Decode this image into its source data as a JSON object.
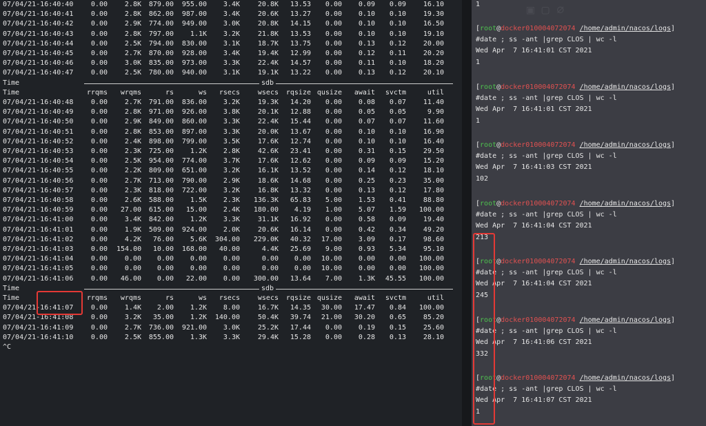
{
  "iostat": {
    "columns": [
      "Time",
      "rrqms",
      "wrqms",
      "rs",
      "ws",
      "rsecs",
      "wsecs",
      "rqsize",
      "qusize",
      "await",
      "svctm",
      "util"
    ],
    "separator_label": "sdb",
    "blocks": [
      {
        "rows": [
          [
            "07/04/21-16:40:40",
            "0.00",
            "2.8K",
            "879.00",
            "955.00",
            "3.4K",
            "20.8K",
            "13.53",
            "0.00",
            "0.09",
            "0.09",
            "16.10"
          ],
          [
            "07/04/21-16:40:41",
            "0.00",
            "2.8K",
            "862.00",
            "987.00",
            "3.4K",
            "20.6K",
            "13.27",
            "0.00",
            "0.10",
            "0.10",
            "19.30"
          ],
          [
            "07/04/21-16:40:42",
            "0.00",
            "2.9K",
            "774.00",
            "949.00",
            "3.0K",
            "20.8K",
            "14.15",
            "0.00",
            "0.10",
            "0.10",
            "16.50"
          ],
          [
            "07/04/21-16:40:43",
            "0.00",
            "2.8K",
            "797.00",
            "1.1K",
            "3.2K",
            "21.8K",
            "13.53",
            "0.00",
            "0.10",
            "0.10",
            "19.10"
          ],
          [
            "07/04/21-16:40:44",
            "0.00",
            "2.5K",
            "794.00",
            "830.00",
            "3.1K",
            "18.7K",
            "13.75",
            "0.00",
            "0.13",
            "0.12",
            "20.00"
          ],
          [
            "07/04/21-16:40:45",
            "0.00",
            "2.7K",
            "870.00",
            "928.00",
            "3.4K",
            "19.4K",
            "12.99",
            "0.00",
            "0.12",
            "0.11",
            "20.20"
          ],
          [
            "07/04/21-16:40:46",
            "0.00",
            "3.0K",
            "835.00",
            "973.00",
            "3.3K",
            "22.4K",
            "14.57",
            "0.00",
            "0.11",
            "0.10",
            "18.20"
          ],
          [
            "07/04/21-16:40:47",
            "0.00",
            "2.5K",
            "780.00",
            "940.00",
            "3.1K",
            "19.1K",
            "13.22",
            "0.00",
            "0.13",
            "0.12",
            "20.10"
          ]
        ]
      },
      {
        "rows": [
          [
            "07/04/21-16:40:48",
            "0.00",
            "2.7K",
            "791.00",
            "836.00",
            "3.2K",
            "19.3K",
            "14.20",
            "0.00",
            "0.08",
            "0.07",
            "11.40"
          ],
          [
            "07/04/21-16:40:49",
            "0.00",
            "2.8K",
            "971.00",
            "926.00",
            "3.8K",
            "20.1K",
            "12.88",
            "0.00",
            "0.05",
            "0.05",
            "9.90"
          ],
          [
            "07/04/21-16:40:50",
            "0.00",
            "2.9K",
            "849.00",
            "860.00",
            "3.3K",
            "22.4K",
            "15.44",
            "0.00",
            "0.07",
            "0.07",
            "11.60"
          ],
          [
            "07/04/21-16:40:51",
            "0.00",
            "2.8K",
            "853.00",
            "897.00",
            "3.3K",
            "20.0K",
            "13.67",
            "0.00",
            "0.10",
            "0.10",
            "16.90"
          ],
          [
            "07/04/21-16:40:52",
            "0.00",
            "2.4K",
            "898.00",
            "799.00",
            "3.5K",
            "17.6K",
            "12.74",
            "0.00",
            "0.10",
            "0.10",
            "16.40"
          ],
          [
            "07/04/21-16:40:53",
            "0.00",
            "2.3K",
            "725.00",
            "1.2K",
            "2.8K",
            "42.6K",
            "23.41",
            "0.00",
            "0.31",
            "0.15",
            "29.50"
          ],
          [
            "07/04/21-16:40:54",
            "0.00",
            "2.5K",
            "954.00",
            "774.00",
            "3.7K",
            "17.6K",
            "12.62",
            "0.00",
            "0.09",
            "0.09",
            "15.20"
          ],
          [
            "07/04/21-16:40:55",
            "0.00",
            "2.2K",
            "809.00",
            "651.00",
            "3.2K",
            "16.1K",
            "13.52",
            "0.00",
            "0.14",
            "0.12",
            "18.10"
          ],
          [
            "07/04/21-16:40:56",
            "0.00",
            "2.7K",
            "713.00",
            "790.00",
            "2.9K",
            "18.6K",
            "14.68",
            "0.00",
            "0.25",
            "0.23",
            "35.00"
          ],
          [
            "07/04/21-16:40:57",
            "0.00",
            "2.3K",
            "818.00",
            "722.00",
            "3.2K",
            "16.8K",
            "13.32",
            "0.00",
            "0.13",
            "0.12",
            "17.80"
          ],
          [
            "07/04/21-16:40:58",
            "0.00",
            "2.6K",
            "588.00",
            "1.5K",
            "2.3K",
            "136.3K",
            "65.83",
            "5.00",
            "1.53",
            "0.41",
            "88.80"
          ],
          [
            "07/04/21-16:40:59",
            "0.00",
            "27.00",
            "615.00",
            "15.00",
            "2.4K",
            "180.00",
            "4.19",
            "1.00",
            "5.07",
            "1.59",
            "100.00"
          ],
          [
            "07/04/21-16:41:00",
            "0.00",
            "3.4K",
            "842.00",
            "1.2K",
            "3.3K",
            "31.1K",
            "16.92",
            "0.00",
            "0.58",
            "0.09",
            "19.40"
          ],
          [
            "07/04/21-16:41:01",
            "0.00",
            "1.9K",
            "509.00",
            "924.00",
            "2.0K",
            "20.6K",
            "16.14",
            "0.00",
            "0.42",
            "0.34",
            "49.20"
          ],
          [
            "07/04/21-16:41:02",
            "0.00",
            "4.2K",
            "76.00",
            "5.6K",
            "304.00",
            "229.0K",
            "40.32",
            "17.00",
            "3.09",
            "0.17",
            "98.60"
          ],
          [
            "07/04/21-16:41:03",
            "0.00",
            "154.00",
            "10.00",
            "168.00",
            "40.00",
            "4.4K",
            "25.69",
            "9.00",
            "0.93",
            "5.34",
            "95.10"
          ],
          [
            "07/04/21-16:41:04",
            "0.00",
            "0.00",
            "0.00",
            "0.00",
            "0.00",
            "0.00",
            "0.00",
            "10.00",
            "0.00",
            "0.00",
            "100.00"
          ],
          [
            "07/04/21-16:41:05",
            "0.00",
            "0.00",
            "0.00",
            "0.00",
            "0.00",
            "0.00",
            "0.00",
            "10.00",
            "0.00",
            "0.00",
            "100.00"
          ],
          [
            "07/04/21-16:41:06",
            "0.00",
            "46.00",
            "0.00",
            "22.00",
            "0.00",
            "300.00",
            "13.64",
            "7.00",
            "1.3K",
            "45.55",
            "100.00"
          ]
        ]
      },
      {
        "rows": [
          [
            "07/04/21-16:41:07",
            "0.00",
            "1.4K",
            "2.00",
            "1.2K",
            "8.00",
            "16.7K",
            "14.35",
            "30.00",
            "17.47",
            "0.84",
            "100.00"
          ],
          [
            "07/04/21-16:41:08",
            "0.00",
            "3.2K",
            "35.00",
            "1.2K",
            "140.00",
            "50.4K",
            "39.74",
            "21.00",
            "30.20",
            "0.65",
            "85.20"
          ],
          [
            "07/04/21-16:41:09",
            "0.00",
            "2.7K",
            "736.00",
            "921.00",
            "3.0K",
            "25.2K",
            "17.44",
            "0.00",
            "0.19",
            "0.15",
            "25.60"
          ],
          [
            "07/04/21-16:41:10",
            "0.00",
            "2.5K",
            "855.00",
            "1.3K",
            "3.3K",
            "29.4K",
            "15.28",
            "0.00",
            "0.28",
            "0.13",
            "28.10"
          ]
        ]
      }
    ],
    "interrupt": "^C"
  },
  "terminal": {
    "first_output": "1",
    "prompt_user": "root",
    "prompt_at": "@",
    "prompt_host": "docker010004072074",
    "prompt_path": "/home/admin/nacos/logs",
    "command": "#date ; ss -ant |grep CLOS | wc -l",
    "entries": [
      {
        "date": "Wed Apr  7 16:41:01 CST 2021",
        "count": "1"
      },
      {
        "date": "Wed Apr  7 16:41:01 CST 2021",
        "count": "1"
      },
      {
        "date": "Wed Apr  7 16:41:03 CST 2021",
        "count": "102"
      },
      {
        "date": "Wed Apr  7 16:41:04 CST 2021",
        "count": "213"
      },
      {
        "date": "Wed Apr  7 16:41:04 CST 2021",
        "count": "245"
      },
      {
        "date": "Wed Apr  7 16:41:06 CST 2021",
        "count": "332"
      },
      {
        "date": "Wed Apr  7 16:41:07 CST 2021",
        "count": "1"
      }
    ]
  },
  "colors": {
    "highlight": "#e53935",
    "user": "#4ec24e",
    "host": "#e05151"
  }
}
